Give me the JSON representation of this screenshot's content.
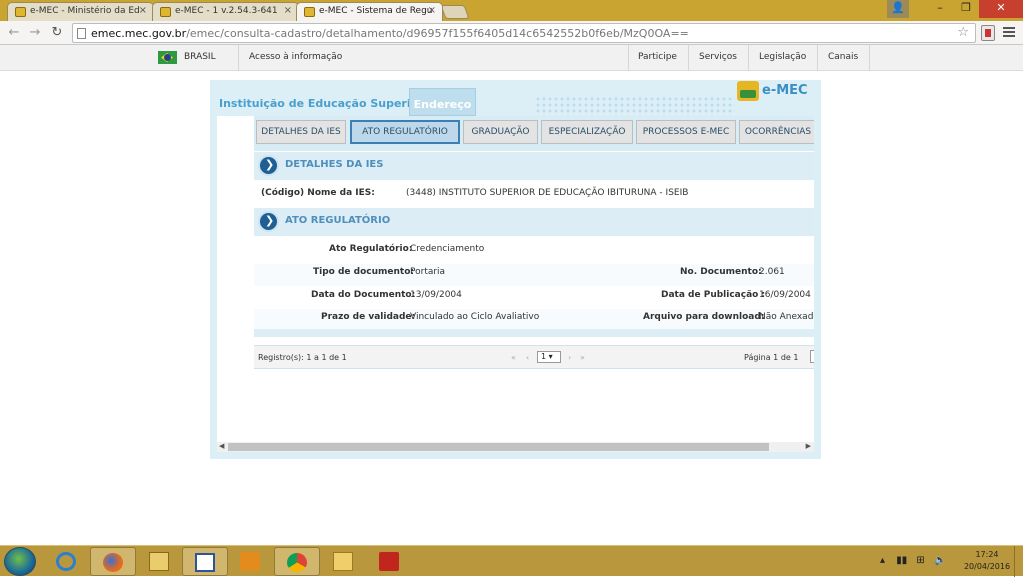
{
  "browser": {
    "tabs": [
      {
        "title": "e-MEC - Ministério da Ed",
        "active": false
      },
      {
        "title": "e-MEC - 1 v.2.54.3-641",
        "active": false
      },
      {
        "title": "e-MEC - Sistema de Regu",
        "active": true
      }
    ],
    "url_host": "emec.mec.gov.br",
    "url_path": "/emec/consulta-cadastro/detalhamento/d96957f155f6405d14c6542552b0f6eb/MzQ0OA=="
  },
  "govbar": {
    "country": "BRASIL",
    "access_info": "Acesso à informação",
    "links": [
      "Participe",
      "Serviços",
      "Legislação",
      "Canais"
    ]
  },
  "panel": {
    "tab_ies": "Instituição de Educação Superior",
    "tab_endereco": "Endereço",
    "logo_text": "e-MEC",
    "subtabs": [
      "DETALHES DA IES",
      "ATO REGULATÓRIO",
      "GRADUAÇÃO",
      "ESPECIALIZAÇÃO",
      "PROCESSOS E-MEC",
      "OCORRÊNCIAS"
    ],
    "active_subtab": "ATO REGULATÓRIO",
    "section_details": "DETALHES DA IES",
    "ies_label": "(Código) Nome da IES:",
    "ies_value": "(3448) INSTITUTO SUPERIOR DE EDUCAÇÃO IBITURUNA - ISEIB",
    "section_ato": "ATO REGULATÓRIO",
    "fields": {
      "ato_label": "Ato Regulatório:",
      "ato_value": "Credenciamento",
      "tipo_label": "Tipo de documento:",
      "tipo_value": "Portaria",
      "num_label": "No. Documento:",
      "num_value": "2.061",
      "data_doc_label": "Data do Documento:",
      "data_doc_value": "13/09/2004",
      "data_pub_label": "Data de Publicação :",
      "data_pub_value": "16/09/2004",
      "prazo_label": "Prazo de validade:",
      "prazo_value": "Vinculado ao Ciclo Avaliativo",
      "arquivo_label": "Arquivo para download:",
      "arquivo_value": "Não Anexado"
    },
    "pager": {
      "records": "Registro(s): 1 a 1 de 1",
      "first": "«",
      "prev": "‹",
      "page_select": "1 ▾",
      "next": "›",
      "last": "»",
      "page_info": "Página 1 de 1"
    }
  },
  "taskbar": {
    "apps": [
      "internet-explorer",
      "firefox",
      "file-explorer",
      "word",
      "media-player",
      "chrome",
      "mail",
      "acrobat"
    ],
    "time": "17:24",
    "date": "20/04/2016"
  }
}
